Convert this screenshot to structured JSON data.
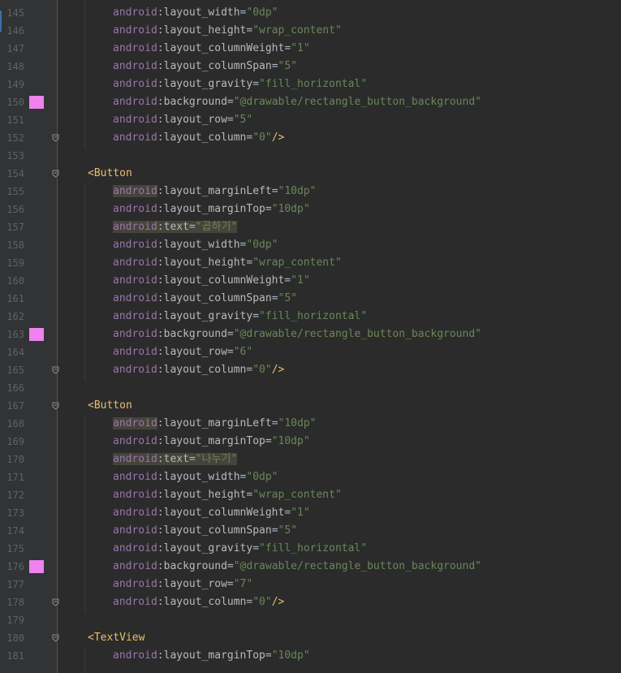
{
  "editor": {
    "colors": {
      "background": "#2b2b2b",
      "gutter": "#313335",
      "namespace": "#9876aa",
      "attribute": "#bababa",
      "value": "#6a8759",
      "tag": "#e8bf6a",
      "swatch": "#ee82ee",
      "highlight": "#45443a"
    },
    "icons": {
      "fold": "fold-arrow-icon",
      "color_swatch": "color-swatch-icon"
    },
    "lines": [
      {
        "num": "145",
        "kind": "attr",
        "ns": "android",
        "sep": ":",
        "attr": "layout_width",
        "eq": "=",
        "value": "\"0dp\""
      },
      {
        "num": "146",
        "kind": "attr",
        "ns": "android",
        "sep": ":",
        "attr": "layout_height",
        "eq": "=",
        "value": "\"wrap_content\""
      },
      {
        "num": "147",
        "kind": "attr",
        "ns": "android",
        "sep": ":",
        "attr": "layout_columnWeight",
        "eq": "=",
        "value": "\"1\""
      },
      {
        "num": "148",
        "kind": "attr",
        "ns": "android",
        "sep": ":",
        "attr": "layout_columnSpan",
        "eq": "=",
        "value": "\"5\""
      },
      {
        "num": "149",
        "kind": "attr",
        "ns": "android",
        "sep": ":",
        "attr": "layout_gravity",
        "eq": "=",
        "value": "\"fill_horizontal\""
      },
      {
        "num": "150",
        "kind": "attr",
        "ns": "android",
        "sep": ":",
        "attr": "background",
        "eq": "=",
        "value": "\"@drawable/rectangle_button_background\"",
        "swatch": true
      },
      {
        "num": "151",
        "kind": "attr",
        "ns": "android",
        "sep": ":",
        "attr": "layout_row",
        "eq": "=",
        "value": "\"5\""
      },
      {
        "num": "152",
        "kind": "attr",
        "ns": "android",
        "sep": ":",
        "attr": "layout_column",
        "eq": "=",
        "value": "\"0\"",
        "close": "/>",
        "fold": true
      },
      {
        "num": "153",
        "kind": "blank"
      },
      {
        "num": "154",
        "kind": "tag",
        "text": "<Button",
        "fold": true
      },
      {
        "num": "155",
        "kind": "attr",
        "ns": "android",
        "sep": ":",
        "attr": "layout_marginLeft",
        "eq": "=",
        "value": "\"10dp\"",
        "hl": "ns"
      },
      {
        "num": "156",
        "kind": "attr",
        "ns": "android",
        "sep": ":",
        "attr": "layout_marginTop",
        "eq": "=",
        "value": "\"10dp\""
      },
      {
        "num": "157",
        "kind": "attr",
        "ns": "android",
        "sep": ":",
        "attr": "text",
        "eq": "=",
        "value": "\"곱하기\"",
        "hl": "all"
      },
      {
        "num": "158",
        "kind": "attr",
        "ns": "android",
        "sep": ":",
        "attr": "layout_width",
        "eq": "=",
        "value": "\"0dp\""
      },
      {
        "num": "159",
        "kind": "attr",
        "ns": "android",
        "sep": ":",
        "attr": "layout_height",
        "eq": "=",
        "value": "\"wrap_content\""
      },
      {
        "num": "160",
        "kind": "attr",
        "ns": "android",
        "sep": ":",
        "attr": "layout_columnWeight",
        "eq": "=",
        "value": "\"1\""
      },
      {
        "num": "161",
        "kind": "attr",
        "ns": "android",
        "sep": ":",
        "attr": "layout_columnSpan",
        "eq": "=",
        "value": "\"5\""
      },
      {
        "num": "162",
        "kind": "attr",
        "ns": "android",
        "sep": ":",
        "attr": "layout_gravity",
        "eq": "=",
        "value": "\"fill_horizontal\""
      },
      {
        "num": "163",
        "kind": "attr",
        "ns": "android",
        "sep": ":",
        "attr": "background",
        "eq": "=",
        "value": "\"@drawable/rectangle_button_background\"",
        "swatch": true
      },
      {
        "num": "164",
        "kind": "attr",
        "ns": "android",
        "sep": ":",
        "attr": "layout_row",
        "eq": "=",
        "value": "\"6\""
      },
      {
        "num": "165",
        "kind": "attr",
        "ns": "android",
        "sep": ":",
        "attr": "layout_column",
        "eq": "=",
        "value": "\"0\"",
        "close": "/>",
        "fold": true
      },
      {
        "num": "166",
        "kind": "blank"
      },
      {
        "num": "167",
        "kind": "tag",
        "text": "<Button",
        "fold": true
      },
      {
        "num": "168",
        "kind": "attr",
        "ns": "android",
        "sep": ":",
        "attr": "layout_marginLeft",
        "eq": "=",
        "value": "\"10dp\"",
        "hl": "ns"
      },
      {
        "num": "169",
        "kind": "attr",
        "ns": "android",
        "sep": ":",
        "attr": "layout_marginTop",
        "eq": "=",
        "value": "\"10dp\""
      },
      {
        "num": "170",
        "kind": "attr",
        "ns": "android",
        "sep": ":",
        "attr": "text",
        "eq": "=",
        "value": "\"나누기\"",
        "hl": "all"
      },
      {
        "num": "171",
        "kind": "attr",
        "ns": "android",
        "sep": ":",
        "attr": "layout_width",
        "eq": "=",
        "value": "\"0dp\""
      },
      {
        "num": "172",
        "kind": "attr",
        "ns": "android",
        "sep": ":",
        "attr": "layout_height",
        "eq": "=",
        "value": "\"wrap_content\""
      },
      {
        "num": "173",
        "kind": "attr",
        "ns": "android",
        "sep": ":",
        "attr": "layout_columnWeight",
        "eq": "=",
        "value": "\"1\""
      },
      {
        "num": "174",
        "kind": "attr",
        "ns": "android",
        "sep": ":",
        "attr": "layout_columnSpan",
        "eq": "=",
        "value": "\"5\""
      },
      {
        "num": "175",
        "kind": "attr",
        "ns": "android",
        "sep": ":",
        "attr": "layout_gravity",
        "eq": "=",
        "value": "\"fill_horizontal\""
      },
      {
        "num": "176",
        "kind": "attr",
        "ns": "android",
        "sep": ":",
        "attr": "background",
        "eq": "=",
        "value": "\"@drawable/rectangle_button_background\"",
        "swatch": true
      },
      {
        "num": "177",
        "kind": "attr",
        "ns": "android",
        "sep": ":",
        "attr": "layout_row",
        "eq": "=",
        "value": "\"7\""
      },
      {
        "num": "178",
        "kind": "attr",
        "ns": "android",
        "sep": ":",
        "attr": "layout_column",
        "eq": "=",
        "value": "\"0\"",
        "close": "/>",
        "fold": true
      },
      {
        "num": "179",
        "kind": "blank"
      },
      {
        "num": "180",
        "kind": "tag",
        "text": "<TextView",
        "fold": true
      },
      {
        "num": "181",
        "kind": "attr",
        "ns": "android",
        "sep": ":",
        "attr": "layout_marginTop",
        "eq": "=",
        "value": "\"10dp\""
      }
    ]
  }
}
